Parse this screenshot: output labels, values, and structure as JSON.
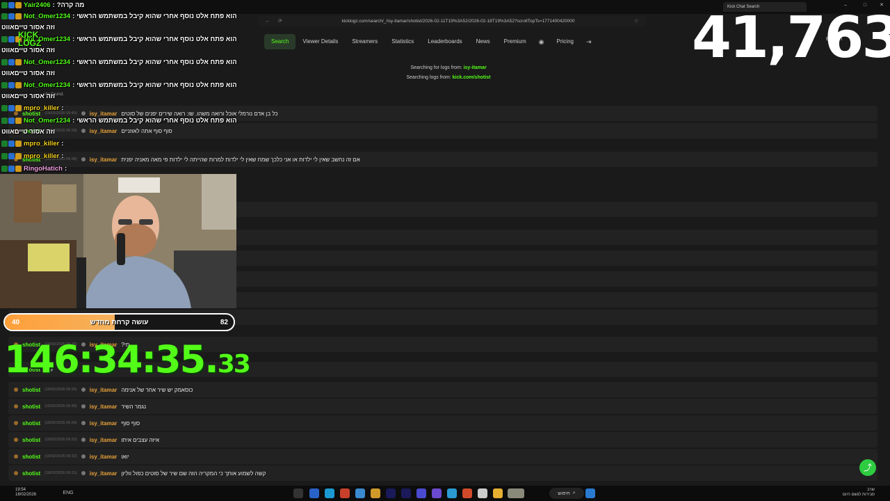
{
  "browser": {
    "tabs": [
      {
        "label": "Kick Chat Search",
        "active": true
      },
      {
        "label": "",
        "active": false
      }
    ],
    "url": "kicklogz.com/search/_/isy-itamar/shotist/2026-02-11T19%3A52/2026-02-18T19%3A52?scrollTopTs=1771400420000"
  },
  "nav": {
    "items": [
      "Search",
      "Viewer Details",
      "Streamers",
      "Statistics",
      "Leaderboards",
      "News",
      "Premium",
      "Pricing"
    ],
    "active": "Search",
    "lang": "English"
  },
  "search_info": {
    "line1_prefix": "Searching for logs from:",
    "line1_user": "isy-itamar",
    "line2_prefix": "Searching logs from:",
    "line2_channel": "kick.com/shotist",
    "results_found": "ults found."
  },
  "results": [
    {
      "channel": "shotist",
      "ts": "(18/02/2026 09:40)",
      "user": "isy_itamar",
      "msg": "כל בן אדם נורמלי אוכל ורואה משהו. שו: רואה שירים יפנים של סוטים"
    },
    {
      "channel": "shotist",
      "ts": "(18/02/2026 09:39)",
      "user": "isy_itamar",
      "msg": "סוף סוף אתה לאוזניים"
    },
    {
      "channel": "shotist",
      "ts": "(18/02/2026 09:38)",
      "user": "isy_itamar",
      "msg": "אם זה נחשב שאין לי ילדות או אני כלכך שמח שאין לי ילדות למרות שהייתה לי ילדות פי מאה מאניה יפנית"
    },
    {
      "channel": "shotist",
      "ts": "(18/02/2026 09:37)",
      "user": "isy_itamar",
      "msg": "אפשרי שתש?"
    },
    {
      "channel": "shotist",
      "ts": "",
      "user": "",
      "msg": ""
    },
    {
      "channel": "shotist",
      "ts": "",
      "user": "",
      "msg": ""
    },
    {
      "channel": "shotist",
      "ts": "",
      "user": "",
      "msg": ""
    },
    {
      "channel": "shotist",
      "ts": "",
      "user": "",
      "msg": ""
    },
    {
      "channel": "shotist",
      "ts": "",
      "user": "",
      "msg": ""
    },
    {
      "channel": "shotist",
      "ts": "(18/02/2026 09:35)",
      "user": "isy_itamar",
      "msg": "מי?"
    },
    {
      "channel": "shotist",
      "ts": "",
      "user": "",
      "msg": ""
    },
    {
      "channel": "shotist",
      "ts": "(18/02/2026 09:35)",
      "user": "isy_itamar",
      "msg": "כוסאמק יש שיר אחר של אנימה"
    },
    {
      "channel": "shotist",
      "ts": "(18/02/2026 09:35)",
      "user": "isy_itamar",
      "msg": "נגמר השיר"
    },
    {
      "channel": "shotist",
      "ts": "(18/02/2026 09:34)",
      "user": "isy_itamar",
      "msg": "סוף סוף"
    },
    {
      "channel": "shotist",
      "ts": "(18/02/2026 09:32)",
      "user": "isy_itamar",
      "msg": "איזה עצבים איתו"
    },
    {
      "channel": "shotist",
      "ts": "(18/02/2026 09:32)",
      "user": "isy_itamar",
      "msg": "יואו"
    },
    {
      "channel": "shotist",
      "ts": "(18/02/2026 09:31)",
      "user": "isy_itamar",
      "msg": "קשה לשמוע אותך כי המקריה הזה שם שיר של סוטים כפול ווליון"
    }
  ],
  "overlay_chat": [
    {
      "user": "Yair2406",
      "color": "green",
      "text": "מה קרה?"
    },
    {
      "user": "Not_Omer1234",
      "color": "green",
      "text": "הוא פתח אלט נוסף אחרי שהוא קיבל במשתמש הראשי"
    },
    {
      "user": "",
      "color": "",
      "text": "וזה אסור טייםאווט"
    },
    {
      "user": "Not_Omer1234",
      "color": "green",
      "text": "הוא פתח אלט נוסף אחרי שהוא קיבל במשתמש הראשי"
    },
    {
      "user": "",
      "color": "",
      "text": "וזה אסור טייםאווט"
    },
    {
      "user": "Not_Omer1234",
      "color": "green",
      "text": "הוא פתח אלט נוסף אחרי שהוא קיבל במשתמש הראשי"
    },
    {
      "user": "",
      "color": "",
      "text": "וזה אסור טייםאווט"
    },
    {
      "user": "Not_Omer1234",
      "color": "green",
      "text": "הוא פתח אלט נוסף אחרי שהוא קיבל במשתמש הראשי"
    },
    {
      "user": "",
      "color": "",
      "text": "וזה אסור טייםאווט"
    },
    {
      "user": "mpro_killer",
      "color": "yellow",
      "text": ""
    },
    {
      "user": "Not_Omer1234",
      "color": "green",
      "text": "הוא פתח אלט נוסף אחרי שהוא קיבל במשתמש הראשי"
    },
    {
      "user": "",
      "color": "",
      "text": "וזה אסור טייםאווט"
    },
    {
      "user": "mpro_killer",
      "color": "yellow",
      "text": ""
    },
    {
      "user": "mpro_killer",
      "color": "yellow",
      "text": ""
    },
    {
      "user": "RingoHatich",
      "color": "pink",
      "text": ""
    }
  ],
  "goal": {
    "min": "40",
    "max": "82",
    "label": "עושה קרחת מחדש",
    "progress": 0.48
  },
  "timer": {
    "main": "146:34:35.",
    "fraction": "33"
  },
  "counter": "41,763",
  "taskbar": {
    "time_left": "19:54",
    "date_left": "18/02/2026",
    "search": "חיפוש",
    "lang": "ENG",
    "weather": "שרב",
    "weather_sub": "סבירות לגשם היום"
  },
  "colors": {
    "accent": "#53fc18",
    "username": "#e8a23a",
    "goal_fill": "#ff9f3a"
  }
}
